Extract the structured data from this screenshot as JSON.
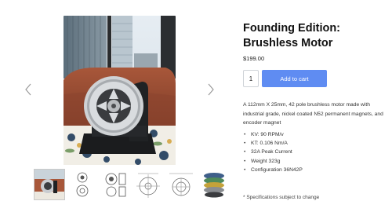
{
  "product": {
    "title": "Founding Edition: Brushless Motor",
    "price": "$199.00",
    "quantity": "1",
    "add_to_cart_label": "Add to cart",
    "description": "A 112mm X 25mm, 42 pole brushless motor made with industrial grade, nickel coated N52 permanent magnets, and encoder magnet",
    "specs": [
      "KV: 90 RPM/v",
      "KT: 0.106 Nm/A",
      "32A Peak Current",
      "Weight 323g",
      "Configuration 36N42P"
    ],
    "footnote": "* Specifications subject to change"
  },
  "gallery": {
    "main_image": "motor-photo-on-stand",
    "thumbnails": [
      {
        "kind": "photo",
        "selected": true
      },
      {
        "kind": "front-drawing",
        "selected": false
      },
      {
        "kind": "side-drawing",
        "selected": false
      },
      {
        "kind": "dimension-drawing",
        "selected": false
      },
      {
        "kind": "dimension-drawing-alt",
        "selected": false
      },
      {
        "kind": "exploded-render",
        "selected": false
      }
    ]
  },
  "icons": {
    "prev": "chevron-left-icon",
    "next": "chevron-right-icon"
  },
  "colors": {
    "accent": "#5f8cf2",
    "text": "#111111"
  }
}
